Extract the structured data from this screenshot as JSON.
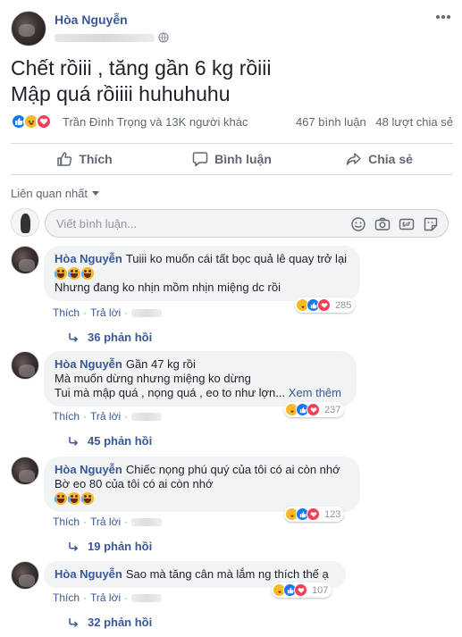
{
  "post": {
    "author": "Hòa Nguyễn",
    "icons": {
      "privacy": "globe-icon",
      "menu": "more-horizontal-icon"
    },
    "lines": [
      "Chết rồiii , tăng gần 6 kg rồiii",
      "Mập quá rồiiii huhuhuhu"
    ],
    "reactions_by": "Trần Đình Trọng và 13K người khác",
    "comments_count": "467 bình luận",
    "shares_count": "48 lượt chia sẻ"
  },
  "actions": {
    "like": "Thích",
    "comment": "Bình luận",
    "share": "Chia sẻ"
  },
  "sort": {
    "label": "Liên quan nhất"
  },
  "composer": {
    "placeholder": "Viết bình luận...",
    "icons": [
      "emoji-icon",
      "camera-icon",
      "gif-icon",
      "sticker-icon"
    ]
  },
  "comments": [
    {
      "author": "Hòa Nguyễn",
      "first_line": "Tuiii ko muốn cái tất bọc quả lê quay trở lại",
      "lines": [
        "Nhưng đang ko nhịn mồm nhịn miệng dc rồi"
      ],
      "reaction_count": "285",
      "like": "Thích",
      "reply": "Trả lời",
      "replies": "36 phản hồi"
    },
    {
      "author": "Hòa Nguyễn",
      "first_line": "Gần 47 kg rồi",
      "lines": [
        "Mà muốn dừng nhưng miệng ko dừng",
        "Tui mà mập quá , nọng quá , eo to như lợn..."
      ],
      "see_more": "Xem thêm",
      "reaction_count": "237",
      "like": "Thích",
      "reply": "Trả lời",
      "replies": "45 phản hồi"
    },
    {
      "author": "Hòa Nguyễn",
      "first_line": "Chiếc nọng phú quý của tôi có ai còn nhớ",
      "lines": [
        "Bờ eo 80 của tôi có ai còn nhớ"
      ],
      "reaction_count": "123",
      "like": "Thích",
      "reply": "Trả lời",
      "replies": "19 phản hồi"
    },
    {
      "author": "Hòa Nguyễn",
      "first_line": "Sao mà tăng cân mà lắm ng thích thế ạ",
      "lines": [],
      "reaction_count": "107",
      "like": "Thích",
      "reply": "Trả lời",
      "replies": "32 phản hồi"
    }
  ],
  "colors": {
    "link": "#385898",
    "like": "#1877f2",
    "haha": "#f7b928",
    "love": "#f33e58",
    "muted": "#606770"
  }
}
